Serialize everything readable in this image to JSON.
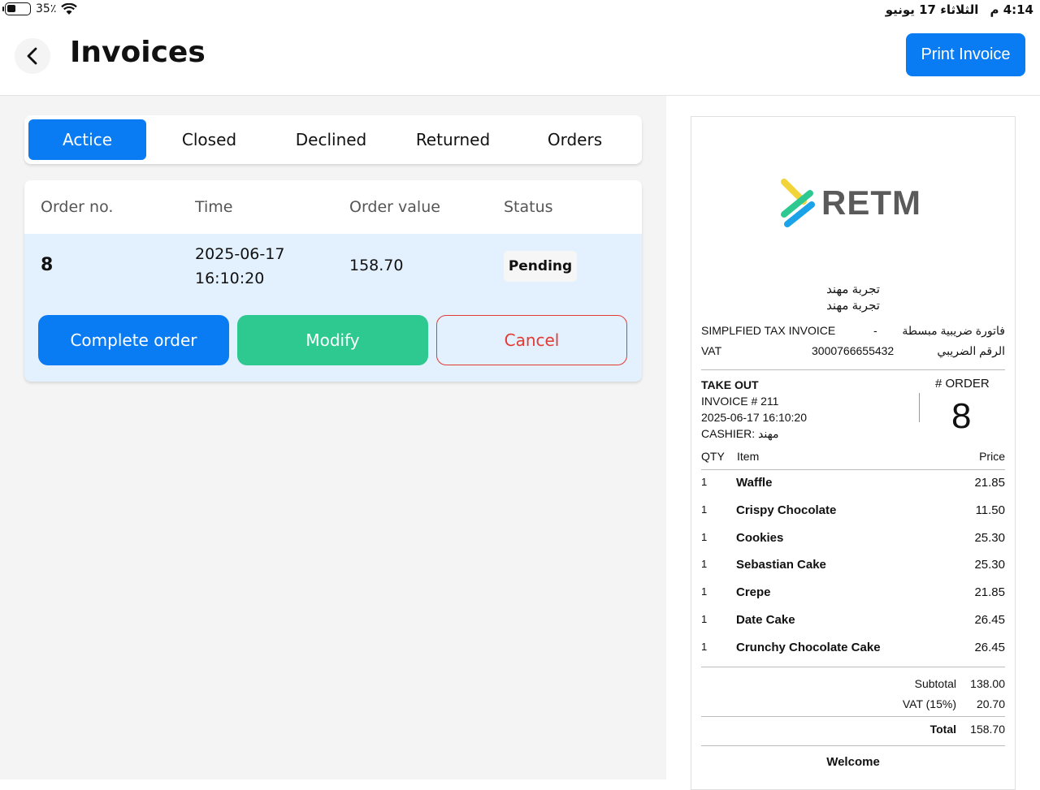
{
  "status_bar": {
    "battery": "35٪",
    "time": "4:14",
    "ampm": "م",
    "date": "الثلاثاء 17 يونيو"
  },
  "header": {
    "title": "Invoices",
    "print_label": "Print Invoice"
  },
  "tabs": [
    {
      "label": "Actice",
      "active": true
    },
    {
      "label": "Closed",
      "active": false
    },
    {
      "label": "Declined",
      "active": false
    },
    {
      "label": "Returned",
      "active": false
    },
    {
      "label": "Orders",
      "active": false
    }
  ],
  "orders_table": {
    "columns": [
      "Order no.",
      "Time",
      "Order value",
      "Status"
    ],
    "rows": [
      {
        "order_no": "8",
        "time": "2025-06-17 16:10:20",
        "value": "158.70",
        "status": "Pending"
      }
    ],
    "actions": {
      "complete": "Complete order",
      "modify": "Modify",
      "cancel": "Cancel"
    }
  },
  "receipt": {
    "logo_text": "RETM",
    "shop_name_1": "تجربة مهند",
    "shop_name_2": "تجربة مهند",
    "invoice_type_en": "SIMPLFIED TAX INVOICE",
    "invoice_type_sep": "-",
    "invoice_type_ar": "فاتورة ضريبية مبسطة",
    "vat_label_en": "VAT",
    "vat_number": "3000766655432",
    "vat_label_ar": "الرقم الضريبي",
    "order_type": "TAKE OUT",
    "invoice_no": "INVOICE # 211",
    "datetime": "2025-06-17 16:10:20",
    "cashier": "CASHIER: مهند",
    "order_label": "# ORDER",
    "order_number": "8",
    "items_head": {
      "qty": "QTY",
      "item": "Item",
      "price": "Price"
    },
    "items": [
      {
        "qty": "1",
        "name": "Waffle",
        "price": "21.85"
      },
      {
        "qty": "1",
        "name": "Crispy Chocolate",
        "price": "11.50"
      },
      {
        "qty": "1",
        "name": "Cookies",
        "price": "25.30"
      },
      {
        "qty": "1",
        "name": "Sebastian Cake",
        "price": "25.30"
      },
      {
        "qty": "1",
        "name": "Crepe",
        "price": "21.85"
      },
      {
        "qty": "1",
        "name": "Date Cake",
        "price": "26.45"
      },
      {
        "qty": "1",
        "name": "Crunchy Chocolate Cake",
        "price": "26.45"
      }
    ],
    "subtotal_label": "Subtotal",
    "subtotal": "138.00",
    "vat_total_label": "VAT (15%)",
    "vat_total": "20.70",
    "total_label": "Total",
    "total": "158.70",
    "footer": "Welcome"
  },
  "colors": {
    "primary": "#0a7cf3",
    "success": "#2ec990",
    "danger": "#e23b35",
    "row_highlight": "#e3f0fd"
  }
}
